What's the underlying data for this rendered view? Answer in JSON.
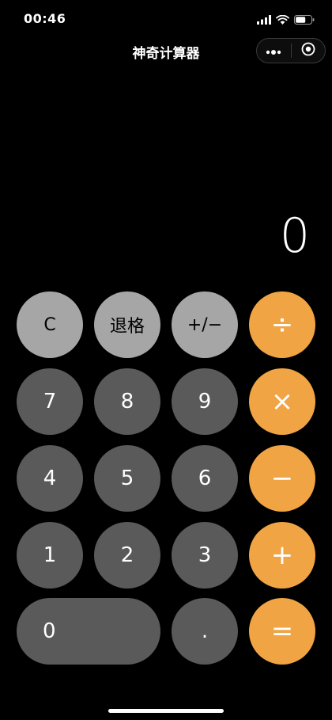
{
  "status_bar": {
    "time": "00:46",
    "icons": [
      "signal-icon",
      "wifi-icon",
      "battery-icon"
    ]
  },
  "nav": {
    "title": "神奇计算器",
    "capsule_icons": [
      "more-icon",
      "close-miniprogram-icon"
    ]
  },
  "display": {
    "value": "0"
  },
  "keys": {
    "clear": "C",
    "backspace": "退格",
    "sign": "+/−",
    "divide": "÷",
    "seven": "7",
    "eight": "8",
    "nine": "9",
    "multiply": "×",
    "four": "4",
    "five": "5",
    "six": "6",
    "subtract": "−",
    "one": "1",
    "two": "2",
    "three": "3",
    "add": "+",
    "zero": "0",
    "decimal": ".",
    "equals": "="
  },
  "colors": {
    "background": "#000000",
    "function_key": "#a6a6a6",
    "number_key": "#5a5a5a",
    "operator_key": "#f0a443"
  }
}
